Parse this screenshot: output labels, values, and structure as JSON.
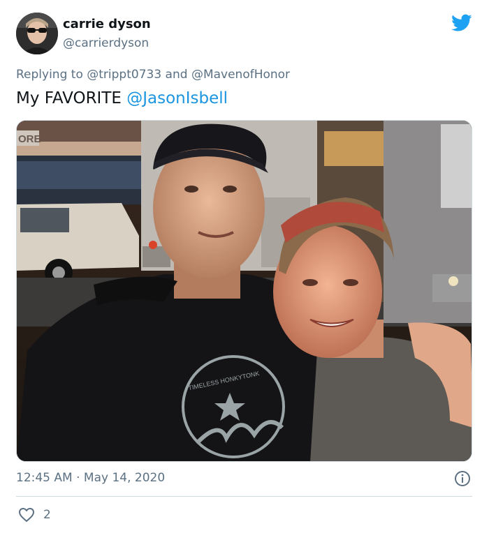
{
  "author": {
    "display_name": "carrie dyson",
    "handle": "@carrierdyson",
    "avatar_icon": "profile-photo"
  },
  "brand": {
    "icon": "twitter-bird-icon",
    "color": "#1da1f2"
  },
  "reply": {
    "prefix": "Replying to",
    "mention_1": "@trippt0733",
    "joiner": "and",
    "mention_2": "@MavenofHonor"
  },
  "tweet": {
    "text": "My FAVORITE",
    "mention": "@JasonIsbell"
  },
  "media": {
    "description": "",
    "shirt_logo_text": "TIMELESS HONKYTONK",
    "sign_text": "ORE"
  },
  "meta": {
    "time": "12:45 AM",
    "separator": "·",
    "date": "May 14, 2020"
  },
  "engagement": {
    "likes": "2"
  },
  "colors": {
    "link": "#1b95e0",
    "secondary_text": "#5b7083",
    "border": "#cfd9de"
  }
}
